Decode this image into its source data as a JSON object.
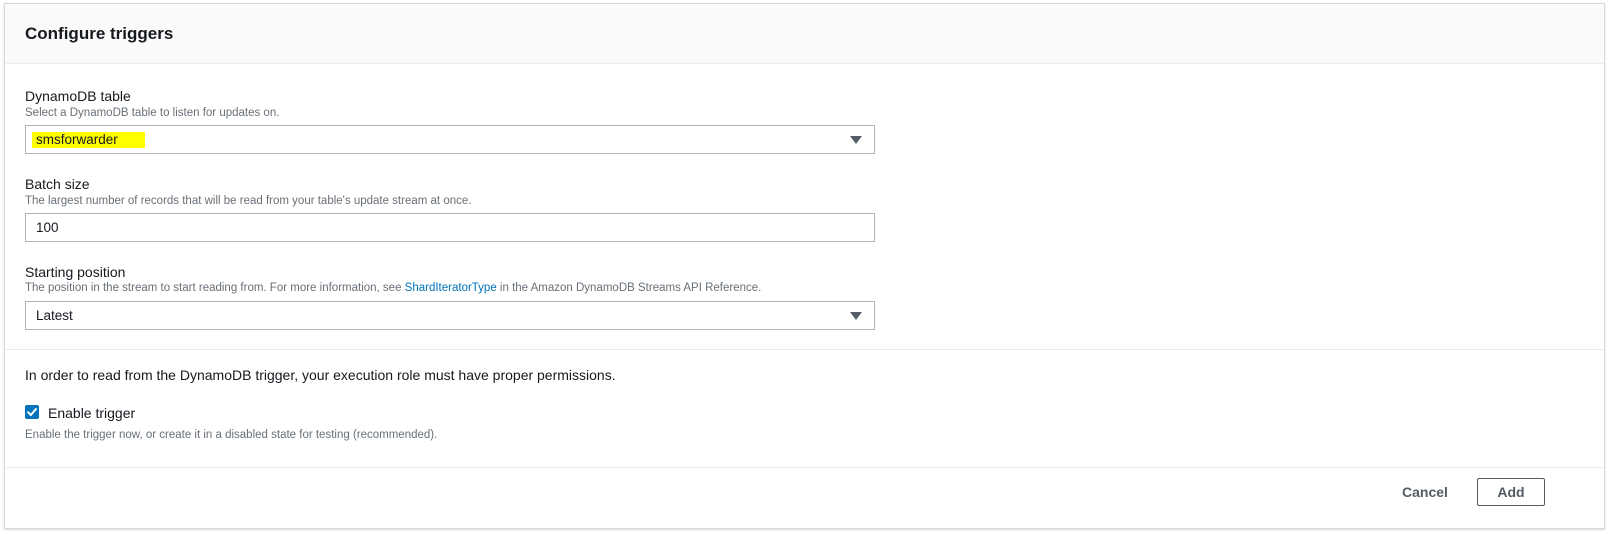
{
  "panel": {
    "title": "Configure triggers"
  },
  "dynamodb_table": {
    "label": "DynamoDB table",
    "description": "Select a DynamoDB table to listen for updates on.",
    "value": "smsforwarder",
    "highlight_color": "#ffff00"
  },
  "batch_size": {
    "label": "Batch size",
    "description": "The largest number of records that will be read from your table's update stream at once.",
    "value": "100"
  },
  "starting_position": {
    "label": "Starting position",
    "description_prefix": "The position in the stream to start reading from. For more information, see ",
    "description_link": "ShardIteratorType",
    "description_suffix": " in the Amazon DynamoDB Streams API Reference.",
    "value": "Latest"
  },
  "permissions_note": "In order to read from the DynamoDB trigger, your execution role must have proper permissions.",
  "enable_trigger": {
    "label": "Enable trigger",
    "checked": true,
    "description": "Enable the trigger now, or create it in a disabled state for testing (recommended)."
  },
  "footer": {
    "cancel_label": "Cancel",
    "add_label": "Add"
  },
  "colors": {
    "accent": "#0073bb",
    "link": "#0073bb",
    "header_bg": "#fafafa"
  },
  "icons": {
    "dropdown": "caret-down-icon",
    "checkbox": "checkmark-icon"
  }
}
